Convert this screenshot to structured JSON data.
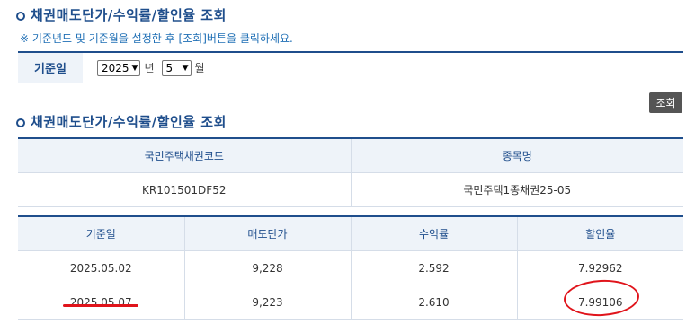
{
  "page": {
    "title": "채권매도단가/수익률/할인율 조회",
    "notice": "※ 기준년도 및 기준월을 설정한 후 [조회]버튼을 클릭하세요."
  },
  "filter": {
    "label": "기준일",
    "year_value": "2025",
    "year_unit": "년",
    "month_value": "5",
    "month_unit": "월"
  },
  "search_button": "조회",
  "results": {
    "title": "채권매도단가/수익률/할인율 조회",
    "bond_table": {
      "headers": [
        "국민주택채권코드",
        "종목명"
      ],
      "row": [
        "KR101501DF52",
        "국민주택1종채권25-05"
      ]
    },
    "price_table": {
      "headers": [
        "기준일",
        "매도단가",
        "수익률",
        "할인율"
      ],
      "rows": [
        [
          "2025.05.02",
          "9,228",
          "2.592",
          "7.92962"
        ],
        [
          "2025.05.07",
          "9,223",
          "2.610",
          "7.99106"
        ]
      ]
    }
  },
  "colors": {
    "accent": "#1f4e8c",
    "notice": "#1f6fb5",
    "annotation": "#e0141b"
  }
}
